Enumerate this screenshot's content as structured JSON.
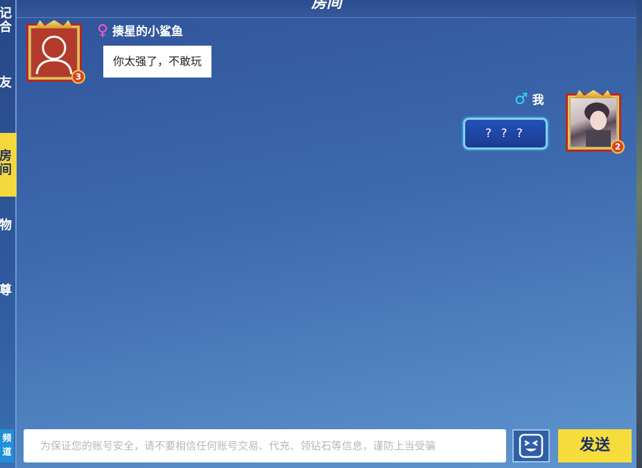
{
  "header": {
    "title": "房间"
  },
  "sidebar": {
    "items": [
      {
        "label": "记合"
      },
      {
        "label": "友"
      },
      {
        "label": "房间"
      },
      {
        "label": "物"
      },
      {
        "label": "尊"
      }
    ],
    "bottom_label": "频道"
  },
  "messages": [
    {
      "sender": "揍星的小鲨鱼",
      "gender_symbol": "♀",
      "level": "3",
      "text": "你太强了，不敢玩"
    },
    {
      "sender": "我",
      "gender_symbol": "♂",
      "level": "2",
      "text": "? ? ?"
    }
  ],
  "composer": {
    "placeholder": "为保证您的账号安全，请不要相信任何账号交易、代充、领钻石等信息，谨防上当受骗",
    "send_label": "发送",
    "emoji_icon": "emoji-face-icon"
  },
  "colors": {
    "accent_yellow": "#f6dd3c",
    "female": "#ff58c8",
    "male": "#2fd8ff"
  }
}
